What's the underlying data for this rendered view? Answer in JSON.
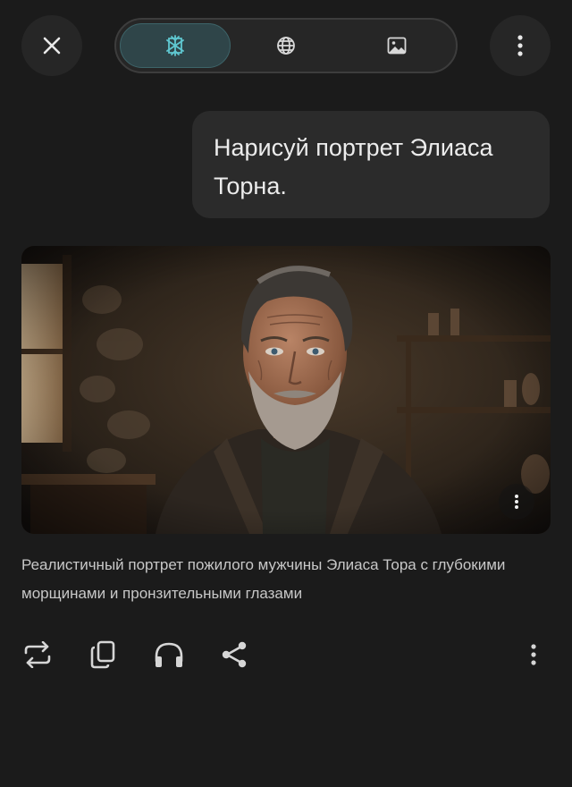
{
  "toolbar": {
    "close_icon": "close-icon",
    "menu_icon": "more-vertical-icon",
    "modes": [
      {
        "name": "sparkle",
        "icon": "sparkle-icon",
        "active": true
      },
      {
        "name": "web",
        "icon": "globe-icon",
        "active": false
      },
      {
        "name": "image",
        "icon": "image-icon",
        "active": false
      }
    ],
    "accent": "#5fc7d0"
  },
  "conversation": {
    "user_message": "Нарисуй портрет Элиаса Торна.",
    "response": {
      "image_icon": "portrait-image",
      "caption": "Реалистичный портрет пожилого мужчины Элиаса Тора с глубокими морщинами и пронзительными глазами"
    }
  },
  "actions": [
    {
      "name": "regenerate",
      "icon": "regenerate-icon"
    },
    {
      "name": "copy",
      "icon": "copy-icon"
    },
    {
      "name": "listen",
      "icon": "headphones-icon"
    },
    {
      "name": "share",
      "icon": "share-icon"
    },
    {
      "name": "more",
      "icon": "more-vertical-icon"
    }
  ]
}
